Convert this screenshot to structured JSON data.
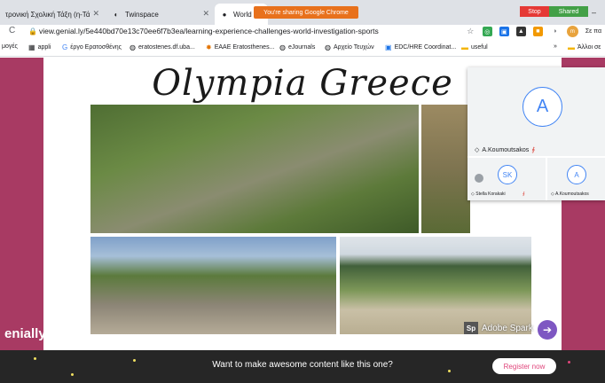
{
  "browser": {
    "tabs": [
      {
        "label": "τρονική Σχολική Τάξη (η-Τά"
      },
      {
        "label": "Twinspace"
      },
      {
        "label": "World Inv"
      }
    ],
    "sharing_notice": "You're sharing Google Chrome",
    "stop_label": "Stop",
    "shared_label": "Shared",
    "url": "view.genial.ly/5e440bd70e13c70ee6f7b3ea/learning-experience-challenges-world-investigation-sports",
    "profile_initial": "m",
    "profile_label": "Σε πα",
    "bookmarks": [
      {
        "label": "μογές"
      },
      {
        "label": "appli"
      },
      {
        "label": "έργο Ερατοσθένης"
      },
      {
        "label": "eratostenes.df.uba..."
      },
      {
        "label": "EAAE Eratosthenes..."
      },
      {
        "label": "eJournals"
      },
      {
        "label": "Αρχείο Τευχών"
      },
      {
        "label": "EDC/HRE Coordinat..."
      },
      {
        "label": "useful"
      },
      {
        "label": "Άλλοι σε"
      }
    ],
    "overflow_chevron": "»"
  },
  "presentation": {
    "title": "Olympia Greece",
    "brand": "enially",
    "spark_logo": "Sp",
    "spark_label": "Adobe Spark",
    "next_icon": "➔"
  },
  "banner": {
    "message": "Want to make awesome content like this one?",
    "register_label": "Register now"
  },
  "meet": {
    "main_initial": "A",
    "main_name": "A.Koumoutsakos",
    "participants": [
      {
        "initial": "SK",
        "name": "Stella Korakaki"
      },
      {
        "initial": "A",
        "name": "A.Koumoutsakos"
      }
    ]
  },
  "colors": {
    "accent": "#a83a63",
    "banner": "#262626",
    "register_text": "#e0457b",
    "sharing": "#e8711c",
    "stop": "#e53935",
    "shared": "#43a047"
  }
}
